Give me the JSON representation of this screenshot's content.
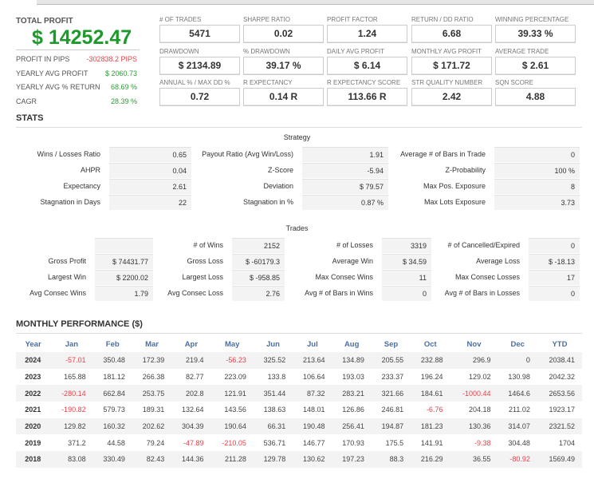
{
  "summary": {
    "total_profit_label": "TOTAL PROFIT",
    "total_profit": "$ 14252.47",
    "rows": [
      {
        "label": "PROFIT IN PIPS",
        "value": "-302838.2 PIPS",
        "tone": "red"
      },
      {
        "label": "YEARLY AVG PROFIT",
        "value": "$ 2060.73",
        "tone": "green"
      },
      {
        "label": "YEARLY AVG % RETURN",
        "value": "68.69 %",
        "tone": "green"
      },
      {
        "label": "CAGR",
        "value": "28.39 %",
        "tone": "green"
      }
    ]
  },
  "metrics": [
    {
      "label": "# OF TRADES",
      "value": "5471"
    },
    {
      "label": "SHARPE RATIO",
      "value": "0.02"
    },
    {
      "label": "PROFIT FACTOR",
      "value": "1.24"
    },
    {
      "label": "RETURN / DD RATIO",
      "value": "6.68"
    },
    {
      "label": "WINNING PERCENTAGE",
      "value": "39.33 %"
    },
    {
      "label": "DRAWDOWN",
      "value": "$ 2134.89"
    },
    {
      "label": "% DRAWDOWN",
      "value": "39.17 %"
    },
    {
      "label": "DAILY AVG PROFIT",
      "value": "$ 6.14"
    },
    {
      "label": "MONTHLY AVG PROFIT",
      "value": "$ 171.72"
    },
    {
      "label": "AVERAGE TRADE",
      "value": "$ 2.61"
    },
    {
      "label": "ANNUAL % / MAX DD %",
      "value": "0.72"
    },
    {
      "label": "R EXPECTANCY",
      "value": "0.14 R"
    },
    {
      "label": "R EXPECTANCY SCORE",
      "value": "113.66 R"
    },
    {
      "label": "STR QUALITY NUMBER",
      "value": "2.42"
    },
    {
      "label": "SQN SCORE",
      "value": "4.88"
    }
  ],
  "stats": {
    "title": "STATS",
    "strategy": {
      "title": "Strategy",
      "rows": [
        [
          [
            "Wins / Losses Ratio",
            "0.65"
          ],
          [
            "Payout Ratio (Avg Win/Loss)",
            "1.91"
          ],
          [
            "Average # of Bars in Trade",
            "0"
          ]
        ],
        [
          [
            "AHPR",
            "0.04"
          ],
          [
            "Z-Score",
            "-5.94"
          ],
          [
            "Z-Probability",
            "100 %"
          ]
        ],
        [
          [
            "Expectancy",
            "2.61"
          ],
          [
            "Deviation",
            "$ 79.57"
          ],
          [
            "Max Pos. Exposure",
            "8"
          ]
        ],
        [
          [
            "Stagnation in Days",
            "22"
          ],
          [
            "Stagnation in %",
            "0.87 %"
          ],
          [
            "Max Lots Exposure",
            "3.73"
          ]
        ]
      ]
    },
    "trades": {
      "title": "Trades",
      "rows": [
        [
          [
            "",
            ""
          ],
          [
            "# of Wins",
            "2152"
          ],
          [
            "# of Losses",
            "3319"
          ],
          [
            "# of Cancelled/Expired",
            "0"
          ]
        ],
        [
          [
            "Gross Profit",
            "$ 74431.77"
          ],
          [
            "Gross Loss",
            "$ -60179.3"
          ],
          [
            "Average Win",
            "$ 34.59"
          ],
          [
            "Average Loss",
            "$ -18.13"
          ]
        ],
        [
          [
            "Largest Win",
            "$ 2200.02"
          ],
          [
            "Largest Loss",
            "$ -958.85"
          ],
          [
            "Max Consec Wins",
            "11"
          ],
          [
            "Max Consec Losses",
            "17"
          ]
        ],
        [
          [
            "Avg Consec Wins",
            "1.79"
          ],
          [
            "Avg Consec Loss",
            "2.76"
          ],
          [
            "Avg # of Bars in Wins",
            "0"
          ],
          [
            "Avg # of Bars in Losses",
            "0"
          ]
        ]
      ]
    }
  },
  "monthly": {
    "title": "MONTHLY PERFORMANCE ($)",
    "headers": [
      "Year",
      "Jan",
      "Feb",
      "Mar",
      "Apr",
      "May",
      "Jun",
      "Jul",
      "Aug",
      "Sep",
      "Oct",
      "Nov",
      "Dec",
      "YTD"
    ],
    "rows": [
      [
        "2024",
        "-57.01",
        "350.48",
        "172.39",
        "219.4",
        "-56.23",
        "325.52",
        "213.64",
        "134.89",
        "205.55",
        "232.88",
        "296.9",
        "0",
        "2038.41"
      ],
      [
        "2023",
        "165.88",
        "181.12",
        "266.38",
        "82.77",
        "223.09",
        "133.8",
        "106.64",
        "193.03",
        "233.37",
        "196.24",
        "129.02",
        "130.98",
        "2042.32"
      ],
      [
        "2022",
        "-280.14",
        "662.84",
        "253.75",
        "202.8",
        "121.91",
        "351.44",
        "87.32",
        "283.21",
        "321.66",
        "184.61",
        "-1000.44",
        "1464.6",
        "2653.56"
      ],
      [
        "2021",
        "-190.82",
        "579.73",
        "189.31",
        "132.64",
        "143.56",
        "138.63",
        "148.01",
        "126.86",
        "246.81",
        "-6.76",
        "204.18",
        "211.02",
        "1923.17"
      ],
      [
        "2020",
        "129.82",
        "160.32",
        "202.62",
        "304.39",
        "190.64",
        "66.31",
        "190.48",
        "256.41",
        "194.87",
        "181.23",
        "130.36",
        "314.07",
        "2321.52"
      ],
      [
        "2019",
        "371.2",
        "44.58",
        "79.24",
        "-47.89",
        "-210.05",
        "536.71",
        "146.77",
        "170.93",
        "175.5",
        "141.91",
        "-9.38",
        "304.48",
        "1704"
      ],
      [
        "2018",
        "83.08",
        "330.49",
        "82.43",
        "144.36",
        "211.28",
        "129.78",
        "130.62",
        "197.23",
        "88.3",
        "216.29",
        "36.55",
        "-80.92",
        "1569.49"
      ]
    ]
  },
  "colors": {
    "profit_green": "#1d9a2b",
    "negative_red": "#e8414a",
    "header_blue": "#4a6fa5"
  }
}
